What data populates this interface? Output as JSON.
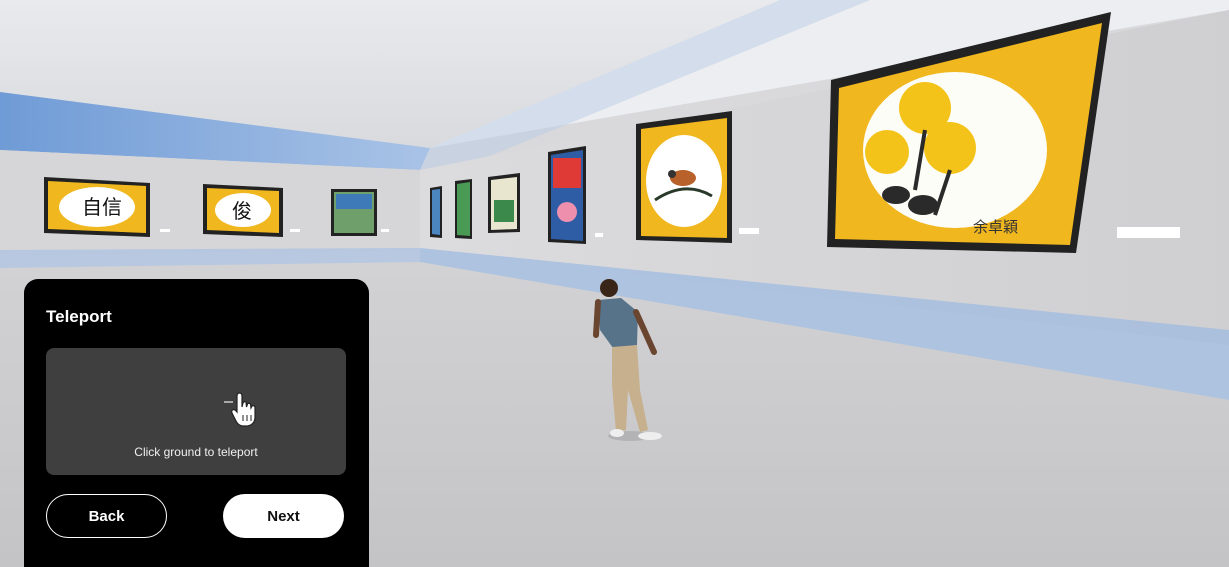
{
  "panel": {
    "title": "Teleport",
    "hint_text": "Click ground to teleport",
    "hint_icon": "pointer-hand-icon",
    "back_label": "Back",
    "next_label": "Next"
  },
  "gallery": {
    "caption_text": "余卓穎",
    "calligraphy_left": "自信",
    "calligraphy_second": "俊"
  },
  "colors": {
    "panel_bg": "#000000",
    "hint_box_bg": "#3f3f3f",
    "artwork_mat": "#f0b71f",
    "next_button_bg": "#ffffff"
  }
}
